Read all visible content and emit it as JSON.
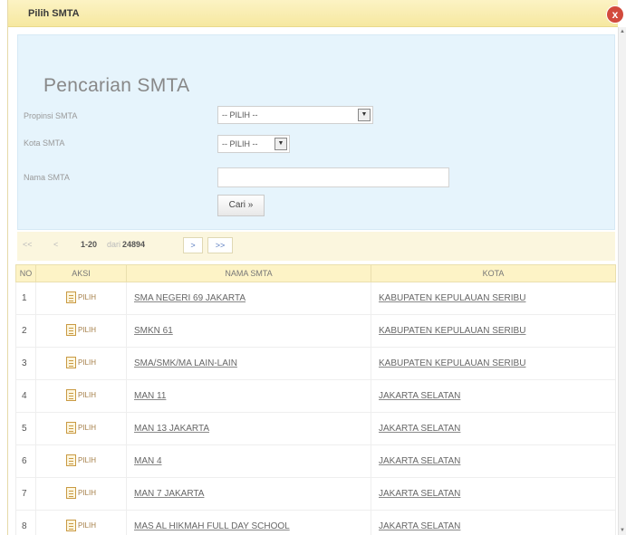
{
  "dialog": {
    "title": "Pilih SMTA",
    "close_icon": "x"
  },
  "search": {
    "heading": "Pencarian SMTA",
    "propinsi_label": "Propinsi SMTA",
    "propinsi_value": "-- PILIH --",
    "kota_label": "Kota SMTA",
    "kota_value": "-- PILIH --",
    "nama_label": "Nama SMTA",
    "nama_value": "",
    "cari_button": "Cari »"
  },
  "pager": {
    "first": "<<",
    "prev": "<",
    "range": "1-20",
    "of": "dari",
    "total": "24894",
    "next": ">",
    "last": ">>"
  },
  "table": {
    "headers": [
      "NO",
      "AKSI",
      "NAMA SMTA",
      "KOTA"
    ],
    "pilih_label": "PILIH",
    "rows": [
      {
        "no": "1",
        "nama": "SMA NEGERI 69 JAKARTA",
        "kota": "KABUPATEN KEPULAUAN SERIBU"
      },
      {
        "no": "2",
        "nama": "SMKN 61",
        "kota": "KABUPATEN KEPULAUAN SERIBU"
      },
      {
        "no": "3",
        "nama": "SMA/SMK/MA LAIN-LAIN",
        "kota": "KABUPATEN KEPULAUAN SERIBU"
      },
      {
        "no": "4",
        "nama": "MAN 11",
        "kota": "JAKARTA SELATAN"
      },
      {
        "no": "5",
        "nama": "MAN 13 JAKARTA",
        "kota": "JAKARTA SELATAN"
      },
      {
        "no": "6",
        "nama": "MAN 4",
        "kota": "JAKARTA SELATAN"
      },
      {
        "no": "7",
        "nama": "MAN 7 JAKARTA",
        "kota": "JAKARTA SELATAN"
      },
      {
        "no": "8",
        "nama": "MAS AL HIKMAH FULL DAY SCHOOL",
        "kota": "JAKARTA SELATAN"
      }
    ]
  }
}
